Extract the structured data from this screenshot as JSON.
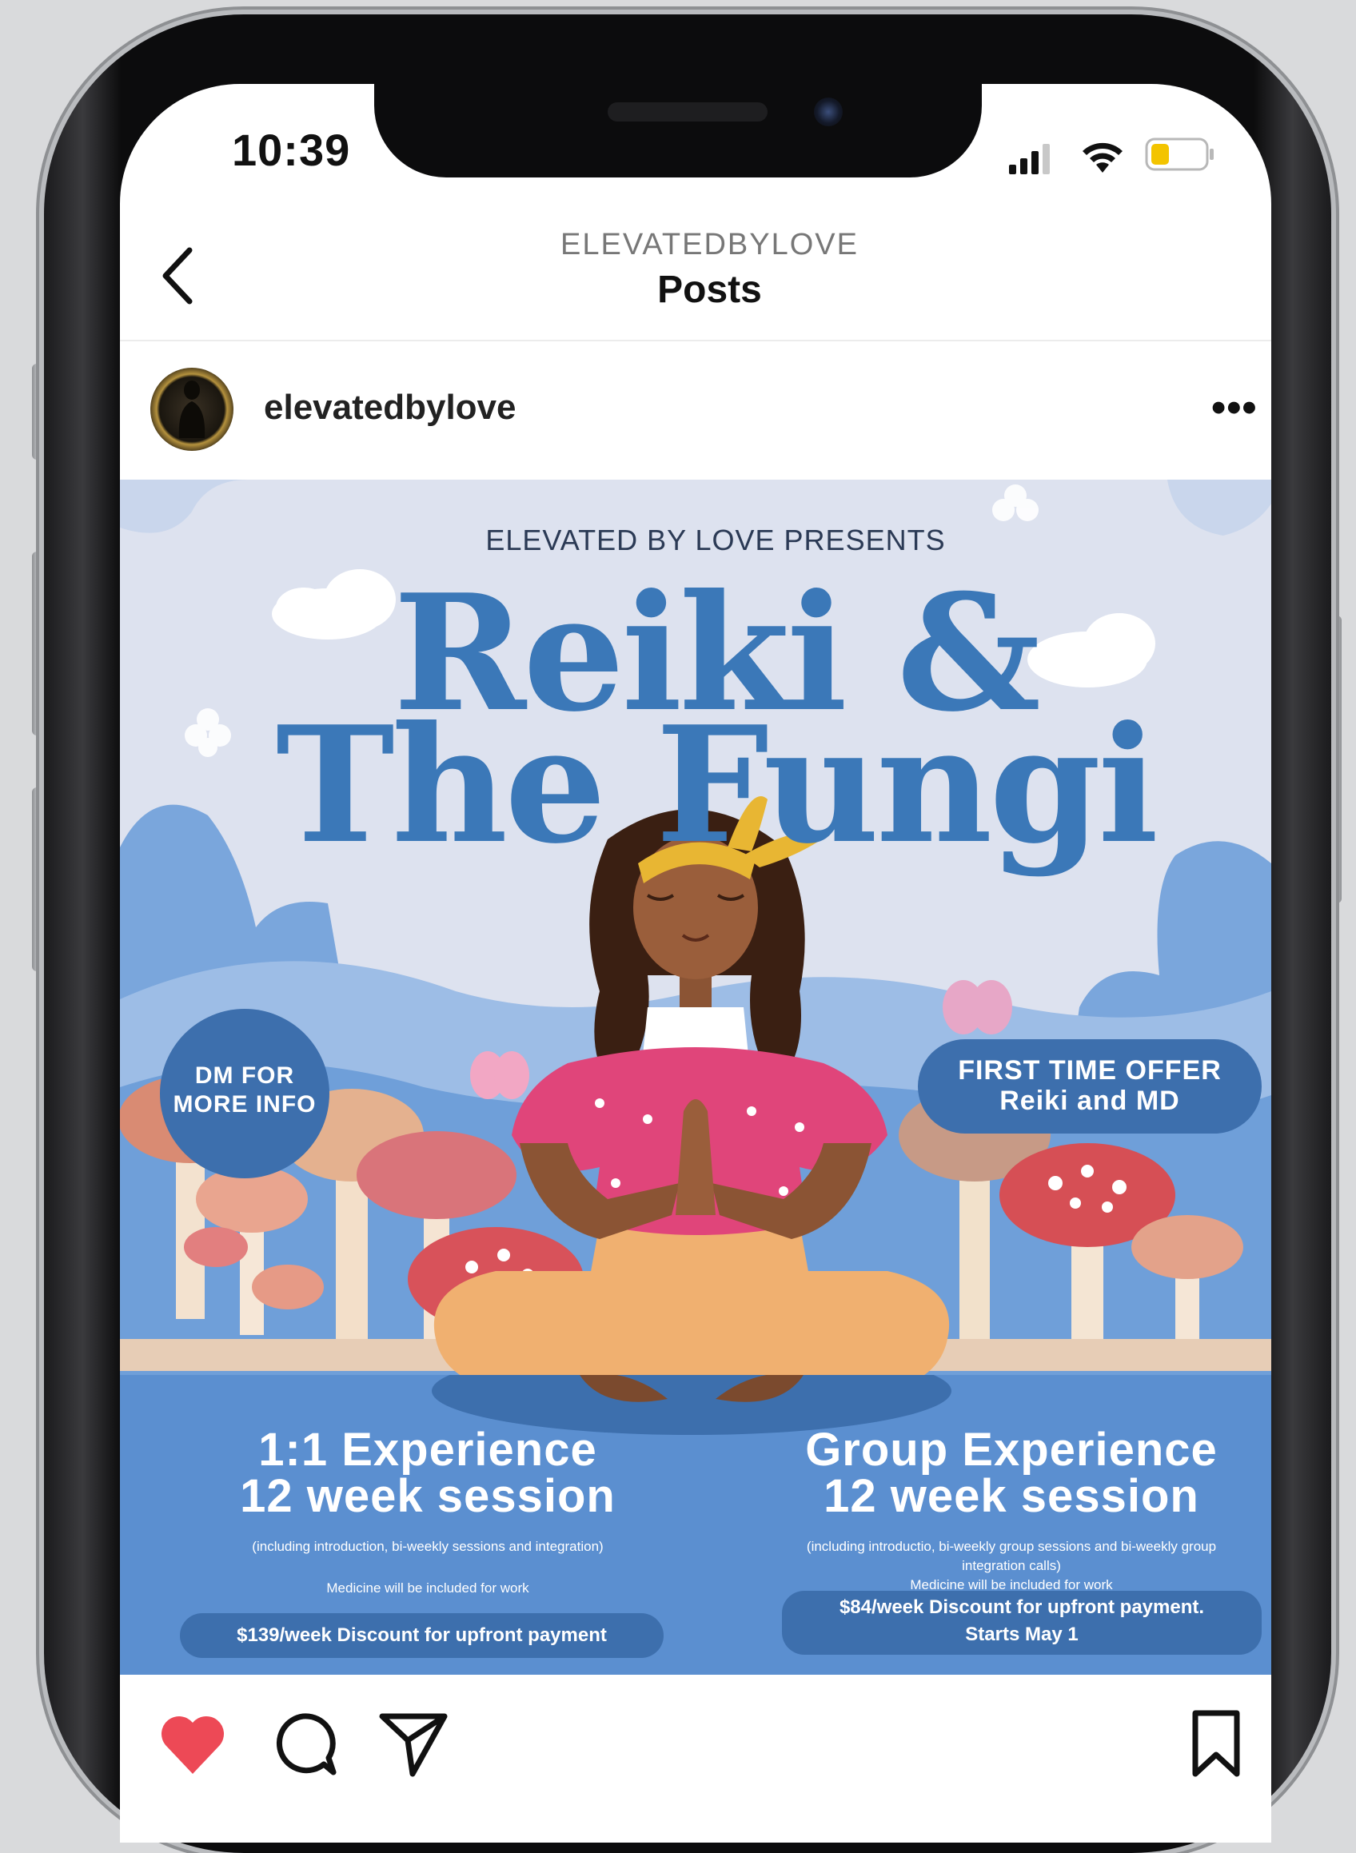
{
  "status_bar": {
    "time": "10:39"
  },
  "header": {
    "username": "ELEVATEDBYLOVE",
    "title": "Posts"
  },
  "post_header": {
    "username": "elevatedbylove",
    "more_label": "•••"
  },
  "flyer": {
    "presents": "ELEVATED BY LOVE PRESENTS",
    "title_line1": "Reiki &",
    "title_line2": "The Fungi",
    "dm_line1": "DM FOR",
    "dm_line2": "MORE INFO",
    "offer_line1": "FIRST TIME OFFER",
    "offer_line2": "Reiki and MD",
    "left": {
      "heading_line1": "1:1 Experience",
      "heading_line2": "12 week session",
      "detail": "(including introduction, bi-weekly sessions and integration)",
      "medicine": "Medicine will be included for work",
      "price": "$139/week Discount for upfront payment"
    },
    "right": {
      "heading_line1": "Group Experience",
      "heading_line2": "12 week session",
      "detail": "(including introductio, bi-weekly group sessions and bi-weekly group integration calls)",
      "medicine": "Medicine will be included for work",
      "price_line1": "$84/week Discount for upfront payment.",
      "price_line2": "Starts May 1"
    }
  },
  "actions": {
    "liked": true,
    "like_color": "#ed4956"
  },
  "colors": {
    "flyer_blue": "#3b78b8",
    "flyer_band": "#5b8fd0",
    "pill": "#3d6fad"
  }
}
